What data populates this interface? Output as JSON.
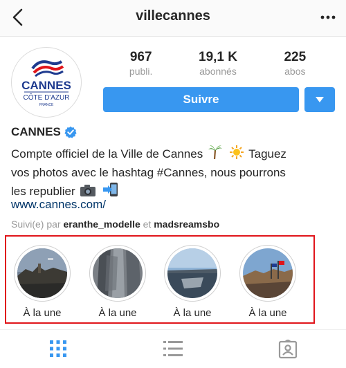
{
  "header": {
    "title": "villecannes",
    "back_icon": "chevron-left-icon",
    "more_icon": "ellipsis-icon"
  },
  "avatar": {
    "brand_text": "CANNES",
    "sub_text": "CÔTE D'AZUR",
    "country_text": "FRANCE",
    "colors": {
      "blue": "#1f3b8f",
      "red": "#e0141a"
    }
  },
  "stats": [
    {
      "value": "967",
      "label": "publi."
    },
    {
      "value": "19,1 K",
      "label": "abonnés"
    },
    {
      "value": "225",
      "label": "abos"
    }
  ],
  "follow": {
    "label": "Suivre",
    "color": "#3897f0",
    "dropdown_icon": "caret-down-icon"
  },
  "profile": {
    "name": "CANNES",
    "verified_icon": "verified-badge-icon",
    "bio_line1": "Compte officiel de la Ville de Cannes",
    "bio_line1_tail": "Taguez",
    "bio_line2": "vos photos avec le hashtag #Cannes, nous pourrons",
    "bio_line3": "les republier",
    "bio_emojis": [
      "palm-tree-icon",
      "sun-icon",
      "camera-icon",
      "phone-arrow-icon"
    ],
    "website": "www.cannes.com/",
    "followed_by_prefix": "Suivi(e) par",
    "followed_by_user1": "eranthe_modelle",
    "followed_by_joiner": "et",
    "followed_by_user2": "madsreamsbo"
  },
  "highlights": [
    {
      "label": "À la une"
    },
    {
      "label": "À la une"
    },
    {
      "label": "À la une"
    },
    {
      "label": "À la une"
    }
  ],
  "tabs": [
    {
      "icon": "grid-icon",
      "active": true
    },
    {
      "icon": "list-icon",
      "active": false
    },
    {
      "icon": "tagged-icon",
      "active": false
    }
  ]
}
